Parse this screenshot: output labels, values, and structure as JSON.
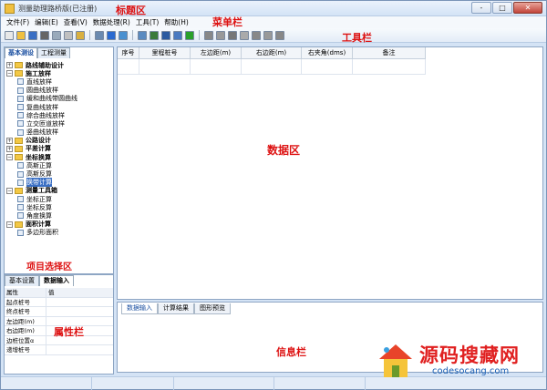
{
  "window": {
    "title": "测量助理路桥版(已注册)",
    "controls": {
      "minimize": "-",
      "maximize": "□",
      "close": "✕"
    }
  },
  "annotations": {
    "title_area": "标题区",
    "menu_bar": "菜单栏",
    "toolbar": "工具栏",
    "data_area": "数据区",
    "project_area": "项目选择区",
    "property_area": "属性栏",
    "info_area": "信息栏"
  },
  "menu": [
    "文件(F)",
    "编辑(E)",
    "查看(V)",
    "数据处理(R)",
    "工具(T)",
    "帮助(H)"
  ],
  "toolbar_icons": [
    "new-icon",
    "open-icon",
    "save-icon",
    "print-icon",
    "preview-icon",
    "copy-icon",
    "paste-icon",
    "settings-icon",
    "run-icon",
    "table-icon",
    "doc-icon",
    "edit-icon",
    "export-icon",
    "calc-icon",
    "check-icon",
    "line-icon",
    "square-icon",
    "zoom-icon",
    "pan-icon",
    "rect-icon",
    "curve-icon",
    "angle-icon"
  ],
  "left_tabs": [
    "基本测设",
    "工程测量"
  ],
  "tree": [
    {
      "label": "路线辅助设计",
      "expanded": false,
      "children": []
    },
    {
      "label": "施工放样",
      "expanded": true,
      "children": [
        "直线放样",
        "圆曲线放样",
        "缓和曲线带圆曲线",
        "复曲线放样",
        "综合曲线放样",
        "立交匝道放样",
        "竖曲线放样"
      ]
    },
    {
      "label": "公路设计",
      "expanded": false,
      "children": []
    },
    {
      "label": "平差计算",
      "expanded": false,
      "children": []
    },
    {
      "label": "坐标换算",
      "expanded": true,
      "children": [
        "高斯正算",
        "高斯反算",
        "换带计算"
      ]
    },
    {
      "label": "测量工具箱",
      "expanded": true,
      "children": [
        "坐标正算",
        "坐标反算",
        "角度换算"
      ]
    },
    {
      "label": "面积计算",
      "expanded": true,
      "children": [
        "多边形面积"
      ]
    }
  ],
  "selected_leaf": "换带计算",
  "prop_tabs": [
    "基本设置",
    "数据输入"
  ],
  "prop_table": {
    "header": {
      "key": "属性",
      "value": "值"
    },
    "rows": [
      "起点桩号",
      "终点桩号",
      "左边距(m)",
      "右边距(m)",
      "边桩位置α",
      "递增桩号"
    ]
  },
  "grid": {
    "columns": [
      "序号",
      "里程桩号",
      "左边距(m)",
      "右边距(m)",
      "右夹角(dms)",
      "备注"
    ]
  },
  "info_tabs": [
    "数据输入",
    "计算结果",
    "图形预览"
  ],
  "watermark": {
    "big": "源码搜藏网",
    "small": "codesocang.com"
  }
}
